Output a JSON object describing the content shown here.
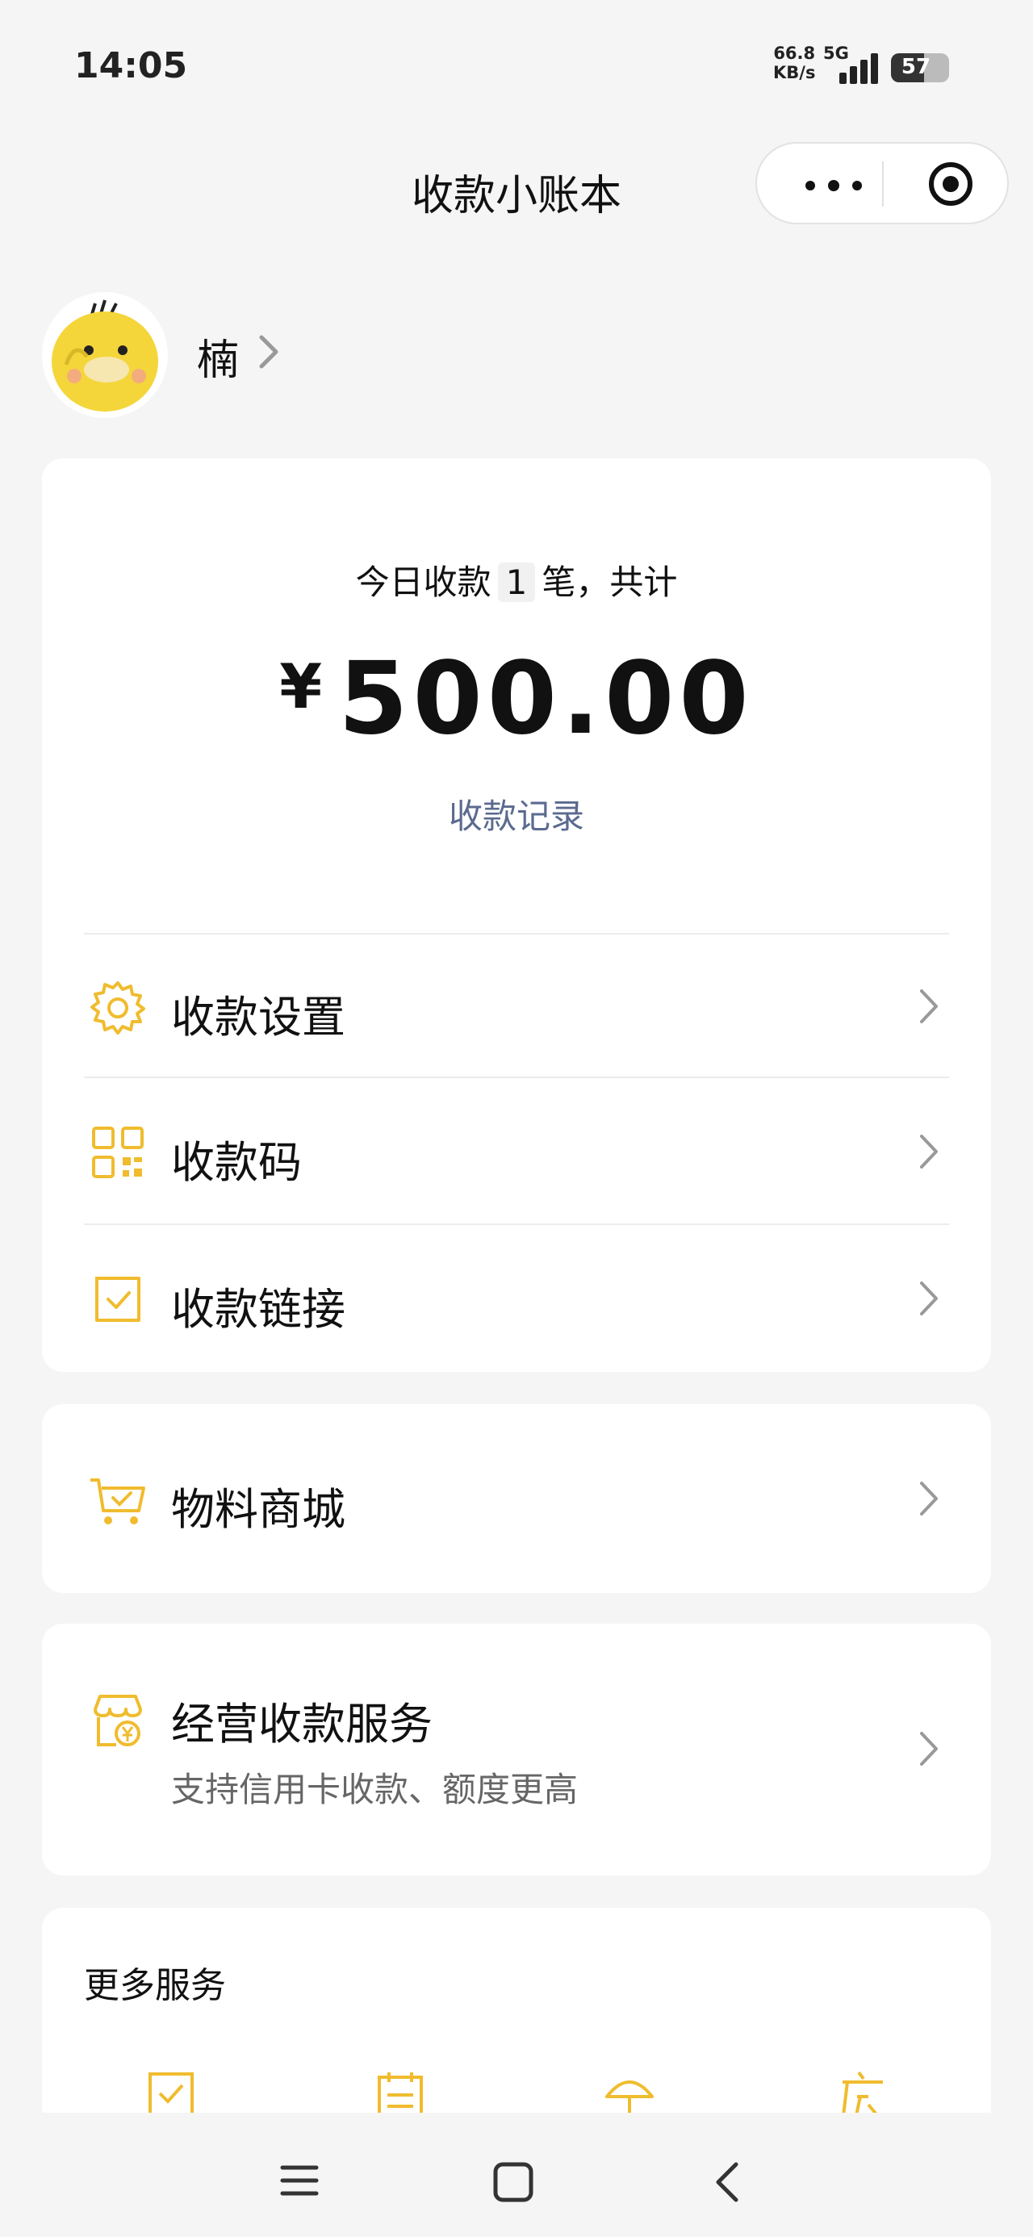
{
  "status_bar": {
    "time": "14:05",
    "net_speed_value": "66.8",
    "net_speed_unit": "KB/s",
    "network": "5G",
    "battery": "57",
    "battery_level": 0.57
  },
  "nav": {
    "title": "收款小账本",
    "more_icon": "more-dots-icon",
    "close_icon": "target-close-icon"
  },
  "profile": {
    "name": "楠",
    "avatar_icon": "yellow-duck-avatar"
  },
  "summary": {
    "prefix": "今日收款",
    "count": "1",
    "suffix": "笔，共计",
    "currency": "¥",
    "amount": "500.00",
    "records_link": "收款记录"
  },
  "menu": {
    "settings": "收款设置",
    "qrcode": "收款码",
    "link": "收款链接"
  },
  "store": {
    "label": "物料商城"
  },
  "service": {
    "title": "经营收款服务",
    "subtitle": "支持信用卡收款、额度更高"
  },
  "more": {
    "title": "更多服务"
  },
  "colors": {
    "accent": "#f0bc2e",
    "link": "#5b6a8f",
    "background": "#f5f5f5"
  },
  "system_nav": {
    "menu_icon": "menu-icon",
    "home_icon": "home-square-icon",
    "back_icon": "back-chevron-icon"
  }
}
